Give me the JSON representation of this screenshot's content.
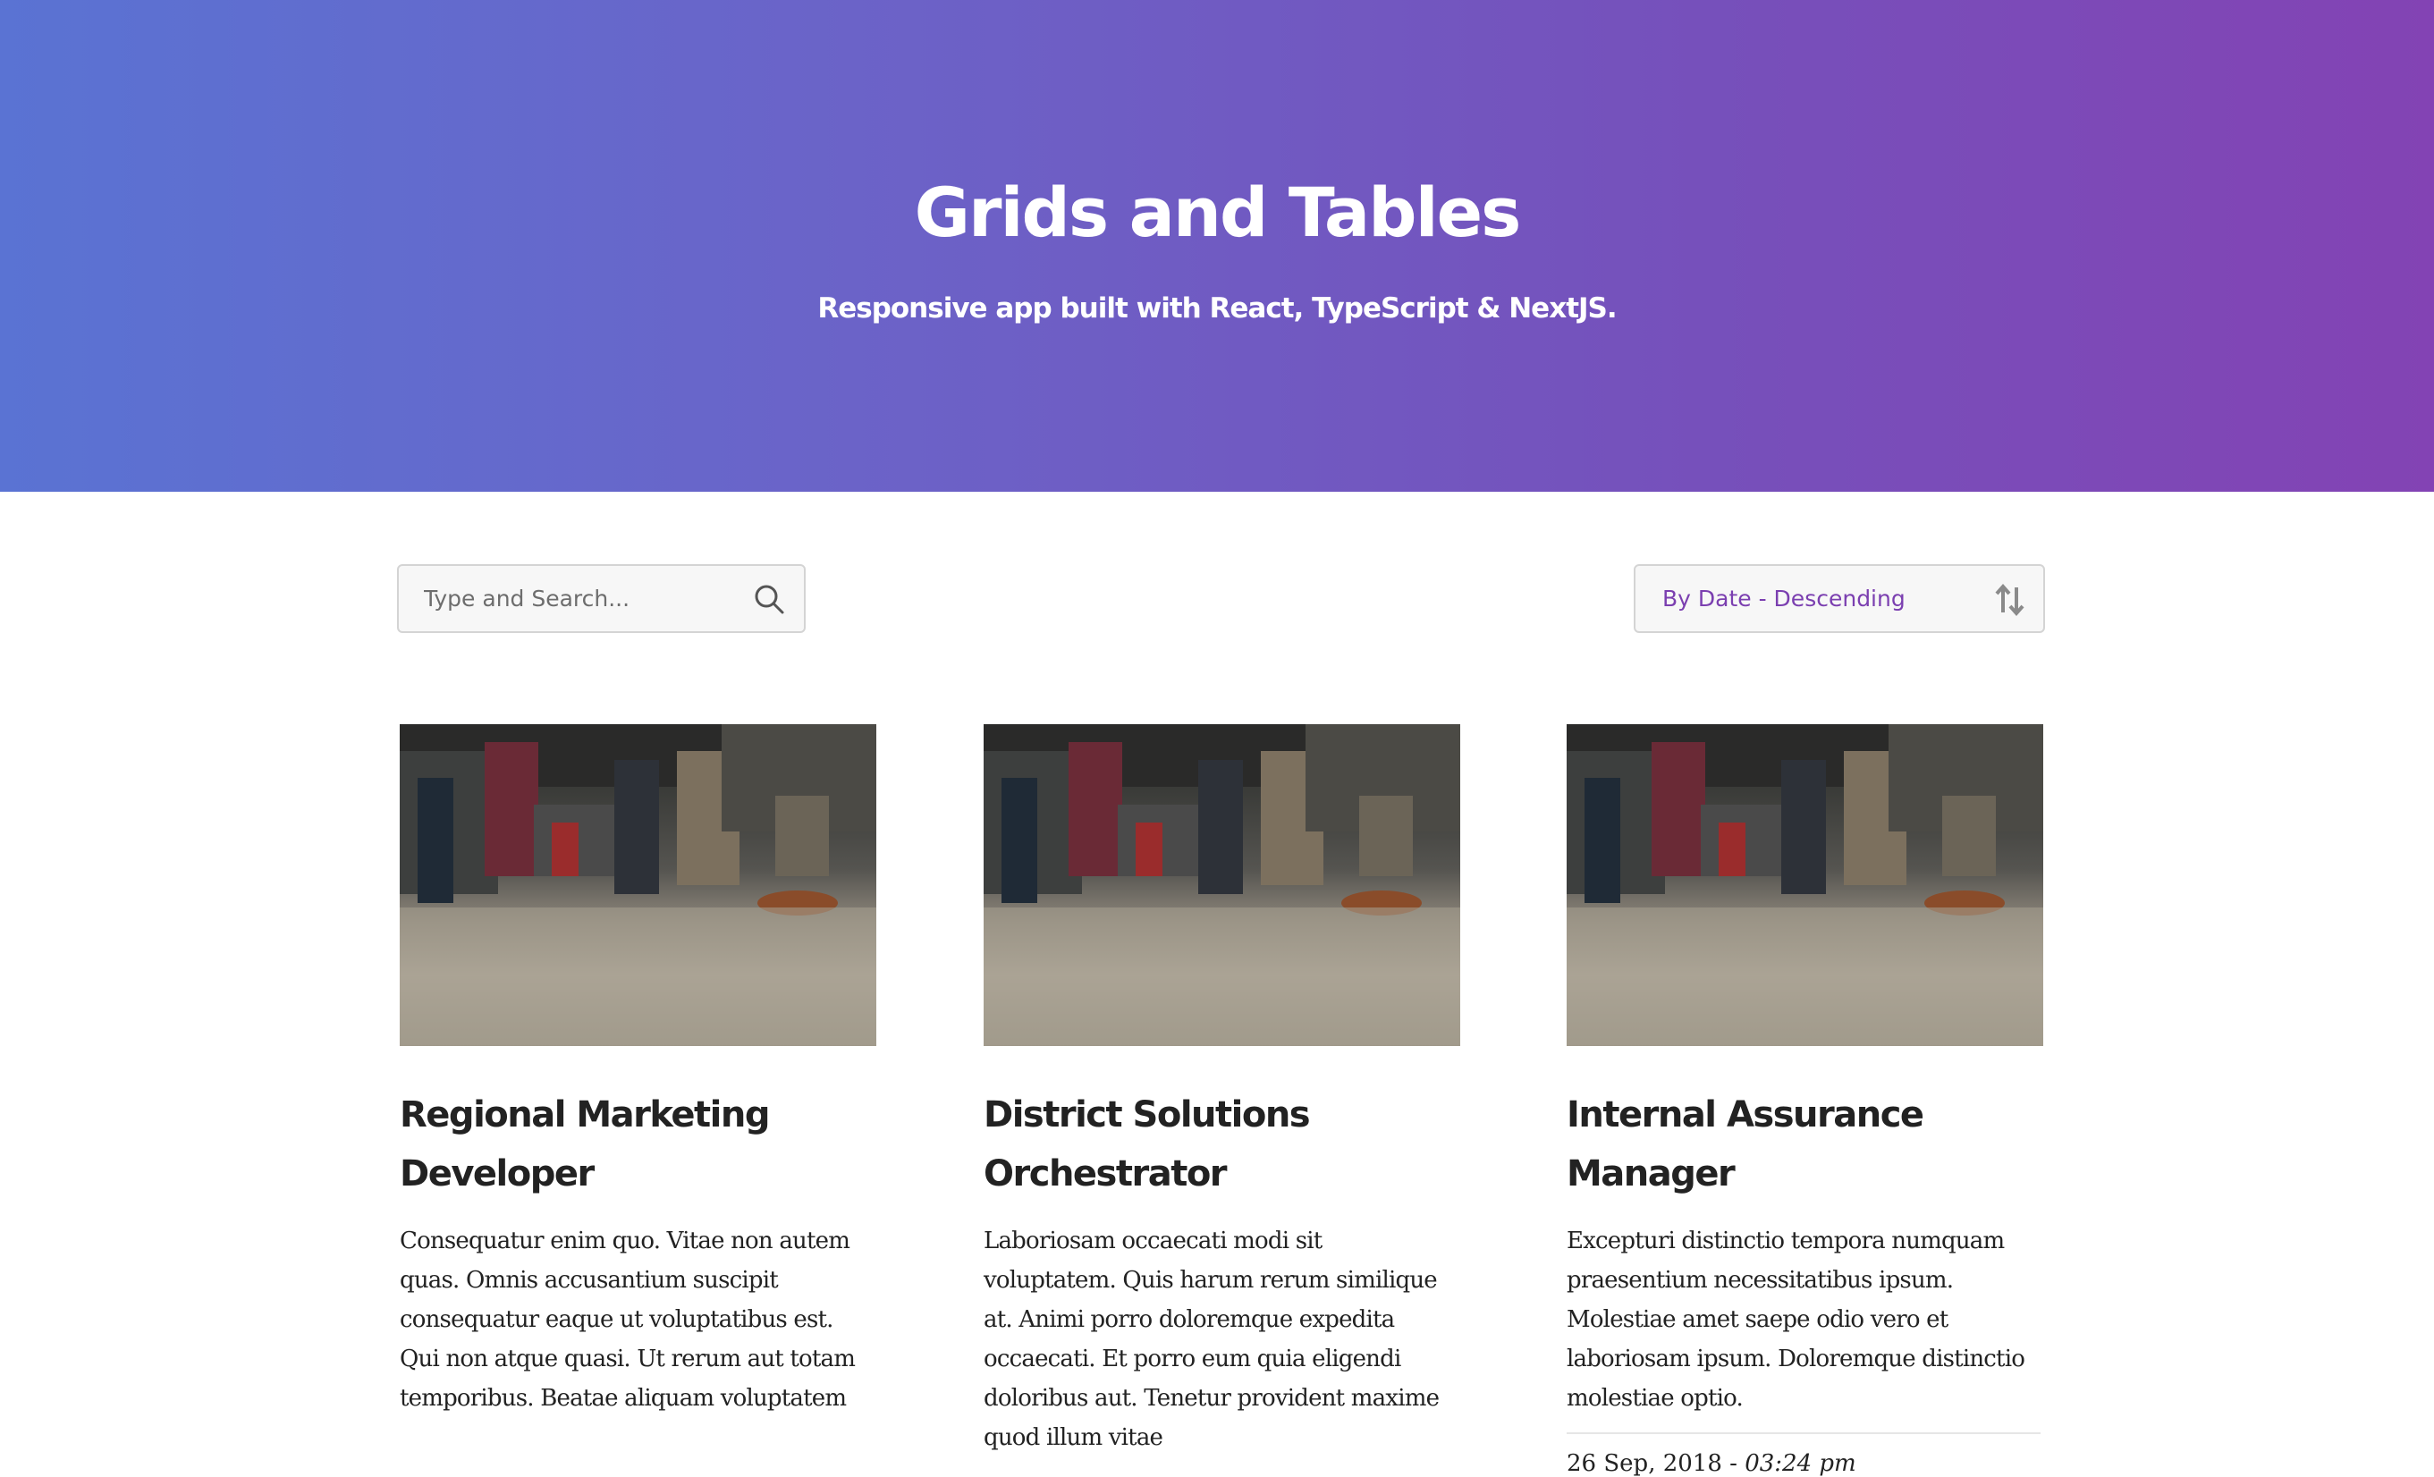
{
  "header": {
    "title": "Grids and Tables",
    "subtitle": "Responsive app built with React, TypeScript & NextJS."
  },
  "search": {
    "placeholder": "Type and Search...",
    "value": ""
  },
  "sort": {
    "label": "By Date - Descending"
  },
  "colors": {
    "gradient_start": "#5a73d3",
    "gradient_end": "#8343b4",
    "accent": "#7b3fb0"
  },
  "icons": {
    "search": "search-icon",
    "sort": "sort-arrows-icon"
  },
  "cards": [
    {
      "title": "Regional Marketing Developer",
      "text": "Consequatur enim quo. Vitae non autem quas. Omnis accusantium suscipit consequatur eaque ut voluptatibus est. Qui non atque quasi. Ut rerum aut totam temporibus. Beatae aliquam voluptatem",
      "date": "",
      "time": ""
    },
    {
      "title": "District Solutions Orchestrator",
      "text": "Laboriosam occaecati modi sit voluptatem. Quis harum rerum similique at. Animi porro doloremque expedita occaecati. Et porro eum quia eligendi doloribus aut. Tenetur provident maxime quod illum vitae",
      "date": "",
      "time": ""
    },
    {
      "title": "Internal Assurance Manager",
      "text": "Excepturi distinctio tempora numquam praesentium necessitatibus ipsum. Molestiae amet saepe odio vero et laboriosam ipsum. Doloremque distinctio molestiae optio.",
      "date": "26 Sep, 2018 - ",
      "time": "03:24 pm"
    }
  ]
}
